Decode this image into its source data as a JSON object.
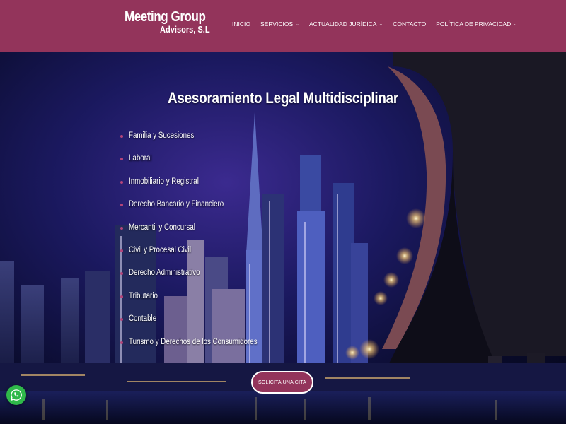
{
  "header": {
    "logo_line1": "Meeting Group",
    "logo_line2": "Advisors, S.L",
    "nav": [
      {
        "label": "INICIO",
        "dropdown": false
      },
      {
        "label": "SERVICIOS",
        "dropdown": true
      },
      {
        "label": "ACTUALIDAD JURÍDICA",
        "dropdown": true
      },
      {
        "label": "CONTACTO",
        "dropdown": false
      },
      {
        "label": "POLÍTICA DE PRIVACIDAD",
        "dropdown": true
      }
    ]
  },
  "hero": {
    "title": "Asesoramiento Legal Multidisciplinar",
    "services": [
      "Familia y Sucesiones",
      "Laboral",
      "Inmobiliario y Registral",
      "Derecho Bancario y Financiero",
      "Mercantil y Concursal",
      "Civil y Procesal Civil",
      "Derecho Administrativo",
      "Tributario",
      "Contable",
      "Turismo y Derechos de los Consumidores"
    ],
    "cta_label": "SOLICITA UNA CITA"
  },
  "icons": {
    "chevron": "chevron-down-icon",
    "whatsapp": "whatsapp-icon",
    "bullet": "bullet-icon"
  },
  "colors": {
    "brand": "#93345b",
    "bullet": "#b5457a",
    "whatsapp": "#2fb84a"
  }
}
